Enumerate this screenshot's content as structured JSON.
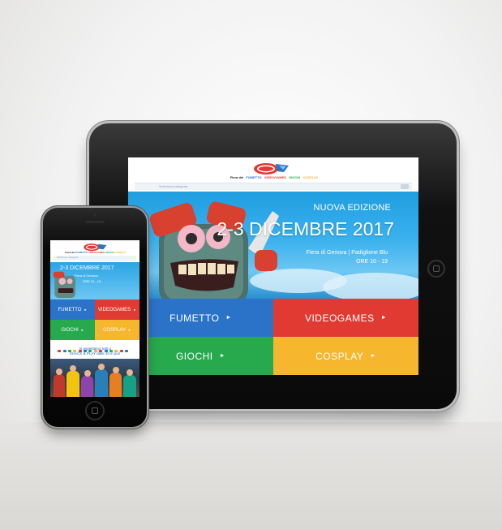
{
  "tablet": {
    "nav": [
      "Fiera del",
      "FUMETTO",
      "VIDEOGAMES",
      "GIOCHI",
      "COSPLAY"
    ],
    "search_placeholder": "Seleziona categoria",
    "hero": {
      "subtitle": "NUOVA EDIZIONE",
      "dates": "2-3 DICEMBRE 2017",
      "venue": "Fiera di Genova | Padiglione Blu",
      "hours": "ORE 10 - 19"
    },
    "tiles": [
      {
        "label": "FUMETTO",
        "color": "#2a73c9"
      },
      {
        "label": "VIDEOGAMES",
        "color": "#e13a32"
      },
      {
        "label": "GIOCHI",
        "color": "#27a94d"
      },
      {
        "label": "COSPLAY",
        "color": "#f6b62d"
      }
    ],
    "arrow": "►"
  },
  "phone": {
    "nav": [
      "Fiera del",
      "FUMETTO",
      "VIDEOGAMES",
      "GIOCHI",
      "COSPLAY"
    ],
    "search_placeholder": "Seleziona categoria",
    "hero": {
      "dates": "2-3 DICEMBRE 2017",
      "venue": "Fiera di Genova",
      "hours": "ORE 10 - 19"
    },
    "tiles": [
      {
        "label": "FUMETTO",
        "color": "#2a73c9"
      },
      {
        "label": "VIDEOGAMES",
        "color": "#e13a32"
      },
      {
        "label": "GIOCHI",
        "color": "#27a94d"
      },
      {
        "label": "COSPLAY",
        "color": "#f6b62d"
      }
    ],
    "promo_line1": "Vi aspettiamo tutti a",
    "promo_line2": "SHACK & PLAY dalle 10 in poi!",
    "arrow": "►"
  },
  "colors": {
    "nav": [
      "#222222",
      "#2a73c9",
      "#e13a32",
      "#27a94d",
      "#f6b62d"
    ],
    "dots": [
      "#e13a32",
      "#2a73c9",
      "#27a94d",
      "#f6b62d",
      "#e13a32",
      "#2a73c9",
      "#27a94d",
      "#f6b62d",
      "#e13a32",
      "#2a73c9",
      "#27a94d",
      "#f6b62d",
      "#e13a32",
      "#2a73c9"
    ]
  }
}
